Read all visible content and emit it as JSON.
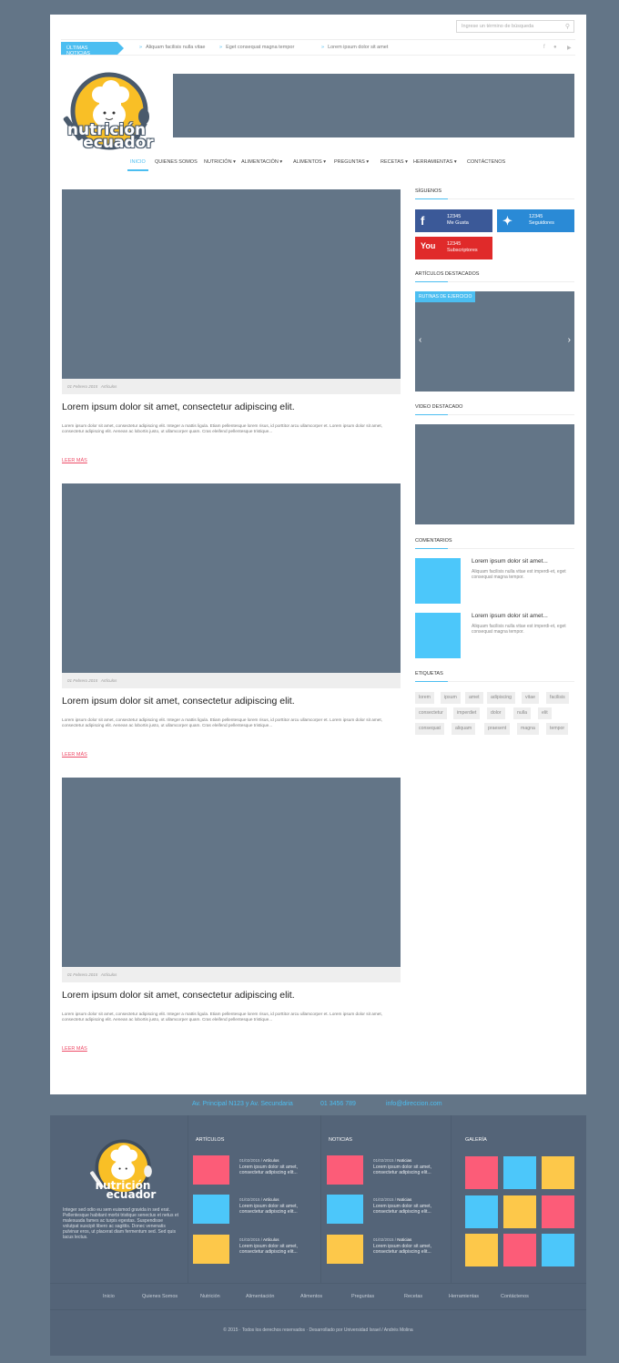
{
  "search": {
    "placeholder": "Ingrese un término de búsqueda",
    "icon": "search-icon"
  },
  "news": {
    "label": "ÚLTIMAS NOTICIAS",
    "items": [
      "Aliquam facilisis nulla vitae",
      "Eget consequat magna tempor",
      "Lorem ipsum dolor sit amet"
    ],
    "social": [
      "f",
      "t",
      "yt"
    ]
  },
  "logo": {
    "line1": "nutrición",
    "line2": "ecuador"
  },
  "nav": [
    "INICIO",
    "QUIENES SOMOS",
    "NUTRICIÓN",
    "ALIMENTACIÓN",
    "ALIMENTOS",
    "PREGUNTAS",
    "RECETAS",
    "HERRAMIENTAS",
    "CONTÁCTENOS"
  ],
  "posts": [
    {
      "date": "01 Febrero 2015",
      "category": "Artículos",
      "title": "Lorem ipsum dolor sit amet, consectetur adipiscing elit.",
      "excerpt": "Lorem ipsum dolor sit amet, consectetur adipiscing elit. Integer a mattis ligula. Etiam pellentesque lorem risus, id porttitor arcu ullamcorper et. Lorem ipsum dolor sit amet, consectetur adipiscing elit. Aenean ac lobortis justo, ut ullamcorper quam. Cras eleifend pellentesque tristique...",
      "more": "LEER MÁS"
    },
    {
      "date": "01 Febrero 2015",
      "category": "Artículos",
      "title": "Lorem ipsum dolor sit amet, consectetur adipiscing elit.",
      "excerpt": "Lorem ipsum dolor sit amet, consectetur adipiscing elit. Integer a mattis ligula. Etiam pellentesque lorem risus, id porttitor arcu ullamcorper et. Lorem ipsum dolor sit amet, consectetur adipiscing elit. Aenean ac lobortis justo, ut ullamcorper quam. Cras eleifend pellentesque tristique...",
      "more": "LEER MÁS"
    },
    {
      "date": "01 Febrero 2015",
      "category": "Artículos",
      "title": "Lorem ipsum dolor sit amet, consectetur adipiscing elit.",
      "excerpt": "Lorem ipsum dolor sit amet, consectetur adipiscing elit. Integer a mattis ligula. Etiam pellentesque lorem risus, id porttitor arcu ullamcorper et. Lorem ipsum dolor sit amet, consectetur adipiscing elit. Aenean ac lobortis justo, ut ullamcorper quam. Cras eleifend pellentesque tristique...",
      "more": "LEER MÁS"
    }
  ],
  "sidebar": {
    "follow_title": "SÍGUENOS",
    "social": [
      {
        "count": "12345",
        "label": "Me Gusta",
        "color": "#3b5998"
      },
      {
        "count": "12345",
        "label": "Seguidores",
        "color": "#2a8ad6"
      },
      {
        "count": "12345",
        "label": "Subscriptores",
        "color": "#e02a2a"
      }
    ],
    "featured_title": "ARTÍCULOS DESTACADOS",
    "carousel_tag": "RUTINAS DE EJERCICIO",
    "video_title": "VIDEO DESTACADO",
    "comments_title": "COMENTARIOS",
    "comments": [
      {
        "title": "Lorem ipsum dolor sit amet...",
        "text": "Aliquam facilisis nulla vitae est imperdi-et, eget consequat magna tempor."
      },
      {
        "title": "Lorem ipsum dolor sit amet...",
        "text": "Aliquam facilisis nulla vitae est imperdi-et, eget consequat magna tempor."
      }
    ],
    "tags_title": "ETIQUETAS",
    "tags": [
      "lorem",
      "ipsum",
      "amet",
      "adipiscing",
      "vitae",
      "facilisis",
      "consectetur",
      "imperdiet",
      "dolor",
      "nulla",
      "elit",
      "consequat",
      "aliquam",
      "praesent",
      "magna",
      "tempor"
    ]
  },
  "contact": {
    "address": "Av. Principal N123 y Av. Secundaria",
    "phone": "01 3456 789",
    "email": "info@direccion.com"
  },
  "footer": {
    "about": "Integer sed odio eu sem euismod gravida in sed erat. Pellentesque habitant morbi tristique senectus et netus et malesuada fames ac turpis egestas. Suspendisse volutpat suscipit libero ac sagittis. Donec venenatis pulvinar eros, ut placerat diam fermentum sed. Sed quis lacus lectus.",
    "articles_title": "ARTÍCULOS",
    "articles": [
      {
        "date": "01/02/2015 /",
        "cat": "Artículos",
        "text": "Lorem ipsum dolor sit amet, consectetur adipiscing elit...",
        "color": "#fc5c78"
      },
      {
        "date": "01/02/2015 /",
        "cat": "Artículos",
        "text": "Lorem ipsum dolor sit amet, consectetur adipiscing elit...",
        "color": "#4cc7fa"
      },
      {
        "date": "01/02/2015 /",
        "cat": "Artículos",
        "text": "Lorem ipsum dolor sit amet, consectetur adipiscing elit...",
        "color": "#fdc84a"
      }
    ],
    "news_title": "NOTICIAS",
    "news": [
      {
        "date": "01/02/2015 /",
        "cat": "Noticias",
        "text": "Lorem ipsum dolor sit amet, consectetur adipiscing elit...",
        "color": "#fc5c78"
      },
      {
        "date": "01/02/2015 /",
        "cat": "Noticias",
        "text": "Lorem ipsum dolor sit amet, consectetur adipiscing elit...",
        "color": "#4cc7fa"
      },
      {
        "date": "01/02/2015 /",
        "cat": "Noticias",
        "text": "Lorem ipsum dolor sit amet, consectetur adipiscing elit...",
        "color": "#fdc84a"
      }
    ],
    "gallery_title": "GALERÍA",
    "gallery": [
      "#fc5c78",
      "#4cc7fa",
      "#fdc84a",
      "#4cc7fa",
      "#fdc84a",
      "#fc5c78",
      "#fdc84a",
      "#fc5c78",
      "#4cc7fa"
    ],
    "nav": [
      "Inicio",
      "Quienes Somos",
      "Nutrición",
      "Alimentación",
      "Alimentos",
      "Preguntas",
      "Recetas",
      "Herramientas",
      "Contáctenos"
    ],
    "copyright": "© 2015 · Todos los derechos reservados · Desarrollado por Universidad Israel / Andrés Molina"
  },
  "colors": {
    "accent": "#4cbef1",
    "pink": "#ee4c68",
    "placeholder": "#637587"
  }
}
